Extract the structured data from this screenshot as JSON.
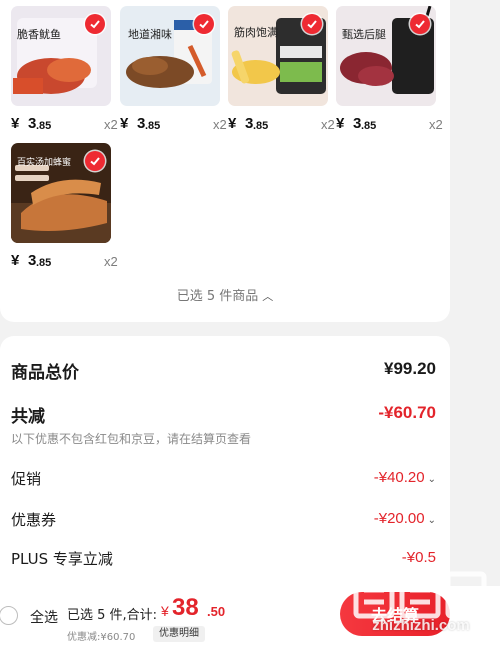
{
  "products": [
    {
      "title": "脆香鱿鱼",
      "price_yen": "¥",
      "price_int": "3",
      "price_dec": ".85",
      "qty": "x2",
      "colors": [
        "#e9e5ef",
        "#c8462d"
      ]
    },
    {
      "title": "地道湘味",
      "price_yen": "¥",
      "price_int": "3",
      "price_dec": ".85",
      "qty": "x2",
      "colors": [
        "#e7eef3",
        "#7a4a26"
      ]
    },
    {
      "title": "筋肉饱满",
      "price_yen": "¥",
      "price_int": "3",
      "price_dec": ".85",
      "qty": "x2",
      "colors": [
        "#f2e6df",
        "#f0c44a"
      ]
    },
    {
      "title": "甄选后腿",
      "price_yen": "¥",
      "price_int": "3",
      "price_dec": ".85",
      "qty": "x2",
      "colors": [
        "#eee9ec",
        "#8c2732"
      ]
    },
    {
      "title": "百实汤加蜂蜜",
      "price_yen": "¥",
      "price_int": "3",
      "price_dec": ".85",
      "qty": "x2",
      "colors": [
        "#3b2516",
        "#c8753a"
      ]
    }
  ],
  "selected_summary": "已选 5 件商品",
  "summary": {
    "goods_total_label": "商品总价",
    "goods_total_value": "¥99.20",
    "total_reduction_label": "共减",
    "total_reduction_value": "-¥60.70",
    "note": "以下优惠不包含红包和京豆，请在结算页查看",
    "promo_label": "促销",
    "promo_value": "-¥40.20",
    "coupon_label": "优惠券",
    "coupon_value": "-¥20.00",
    "plus_label": "PLUS 专享立减",
    "plus_value": "-¥0.5"
  },
  "bottom_bar": {
    "select_all": "全选",
    "selected_count": "已选 5 件,合计:",
    "total_yen": "¥",
    "total_int": "38",
    "total_dec": ".50",
    "discount_line": "优惠减:¥60.70",
    "detail_button": "优惠明细",
    "checkout_button": "去结算"
  },
  "watermark": {
    "url": "zhizhizhi.com"
  },
  "colors": {
    "accent_red": "#e3242b",
    "check_badge": "#ee2a32"
  }
}
